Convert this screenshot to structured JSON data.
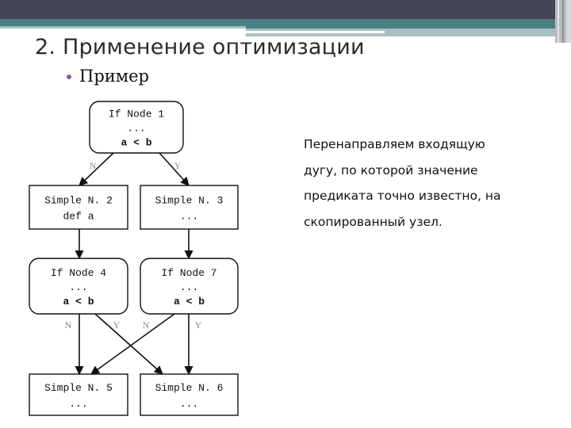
{
  "slide": {
    "title": "2. Применение оптимизации",
    "bullet": "Пример",
    "description_lines": [
      "Перенаправляем входящую",
      "дугу, по которой значение",
      "предиката точно известно, на",
      "скопированный узел."
    ],
    "colors": {
      "header_dark": "#434556",
      "header_teal": "#4a7f84",
      "header_light": "#a7bfc2",
      "bullet": "#8c5c9e"
    }
  },
  "diagram": {
    "nodes": {
      "n1": {
        "shape": "rounded",
        "lines": [
          "If Node 1",
          "...",
          "a < b"
        ]
      },
      "n2": {
        "shape": "rect",
        "lines": [
          "Simple N. 2",
          "def a"
        ]
      },
      "n3": {
        "shape": "rect",
        "lines": [
          "Simple N. 3",
          "..."
        ]
      },
      "n4": {
        "shape": "rounded",
        "lines": [
          "If Node 4",
          "...",
          "a < b"
        ]
      },
      "n7": {
        "shape": "rounded",
        "lines": [
          "If Node 7",
          "...",
          "a < b"
        ]
      },
      "n5": {
        "shape": "rect",
        "lines": [
          "Simple N. 5",
          "..."
        ]
      },
      "n6": {
        "shape": "rect",
        "lines": [
          "Simple N. 6",
          "..."
        ]
      }
    },
    "edges": [
      {
        "from": "n1",
        "to": "n2",
        "label": "N"
      },
      {
        "from": "n1",
        "to": "n3",
        "label": "Y"
      },
      {
        "from": "n2",
        "to": "n4",
        "label": ""
      },
      {
        "from": "n3",
        "to": "n7",
        "label": ""
      },
      {
        "from": "n4",
        "to": "n5",
        "label": "N"
      },
      {
        "from": "n4",
        "to": "n6",
        "label": "Y"
      },
      {
        "from": "n7",
        "to": "n5",
        "label": "N"
      },
      {
        "from": "n7",
        "to": "n6",
        "label": "Y"
      }
    ]
  }
}
